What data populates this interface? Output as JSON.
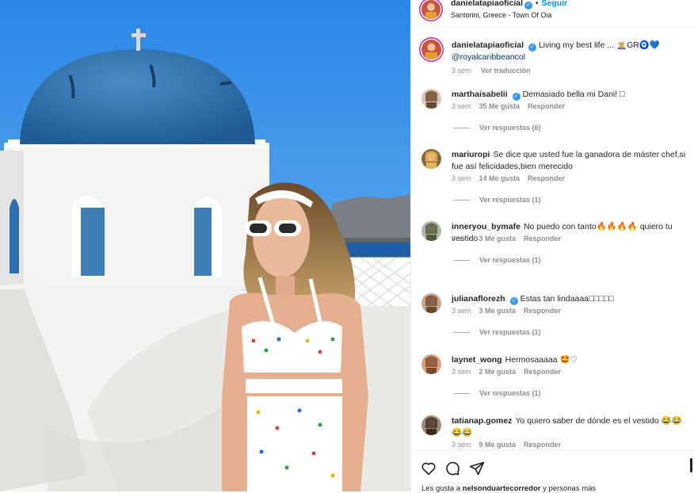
{
  "post": {
    "username": "danielatapiaoficial",
    "follow_label": "Seguir",
    "separator": "•",
    "location": "Santorini, Greece - Town Of Oia",
    "verified_icon": "✓"
  },
  "caption": {
    "username": "danielatapiaoficial",
    "text": "Living my best life ... 🧝‍♀️",
    "text_tail": "GR🧿💙",
    "mention": "@royalcaribbeancol",
    "time": "3 sem",
    "translate": "Ver traducción"
  },
  "comments": [
    {
      "username": "marthaisabelii",
      "verified": true,
      "text": "Demasiado bella mi Dani! □",
      "time": "3 sem",
      "likes": "35 Me gusta",
      "reply": "Responder",
      "replies": "Ver respuestas (6)"
    },
    {
      "username": "mariuropi",
      "verified": false,
      "text": "Se dice que usted fue la ganadora de máster chef,si fue así felicidades,bien merecido",
      "time": "3 sem",
      "likes": "14 Me gusta",
      "reply": "Responder",
      "replies": "Ver respuestas (1)"
    },
    {
      "username": "inneryou_bymafe",
      "verified": false,
      "text": "No puedo con tanto🔥🔥🔥🔥 quiero tu vestido",
      "time": "3 sem",
      "likes": "3 Me gusta",
      "reply": "Responder",
      "replies": "Ver respuestas (1)"
    },
    {
      "username": "julianaflorezh",
      "verified": true,
      "text": "Estas tan lindaaaa□□□□□",
      "time": "3 sem",
      "likes": "3 Me gusta",
      "reply": "Responder",
      "replies": "Ver respuestas (1)"
    },
    {
      "username": "laynet_wong",
      "verified": false,
      "text": "Hermosaaaaa 🤩♡",
      "time": "3 sem",
      "likes": "2 Me gusta",
      "reply": "Responder",
      "replies": "Ver respuestas (1)"
    },
    {
      "username": "tatianap.gomez",
      "verified": false,
      "text": "Yo quiero saber de dónde es el vestido 😂😂😂😂",
      "time": "3 sem",
      "likes": "9 Me gusta",
      "reply": "Responder",
      "replies": ""
    }
  ],
  "actions": {
    "like_icon": "heart-icon",
    "comment_icon": "comment-icon",
    "share_icon": "share-icon"
  },
  "likes_line": {
    "prefix": "Les gusta a ",
    "user": "nelsonduartecorredor",
    "suffix": " y personas más"
  },
  "colors": {
    "accent": "#0095f6",
    "verified": "#3897f0",
    "muted": "#8e8e8e",
    "sky": "#3a8ee8",
    "dome": "#2f6fb0"
  }
}
